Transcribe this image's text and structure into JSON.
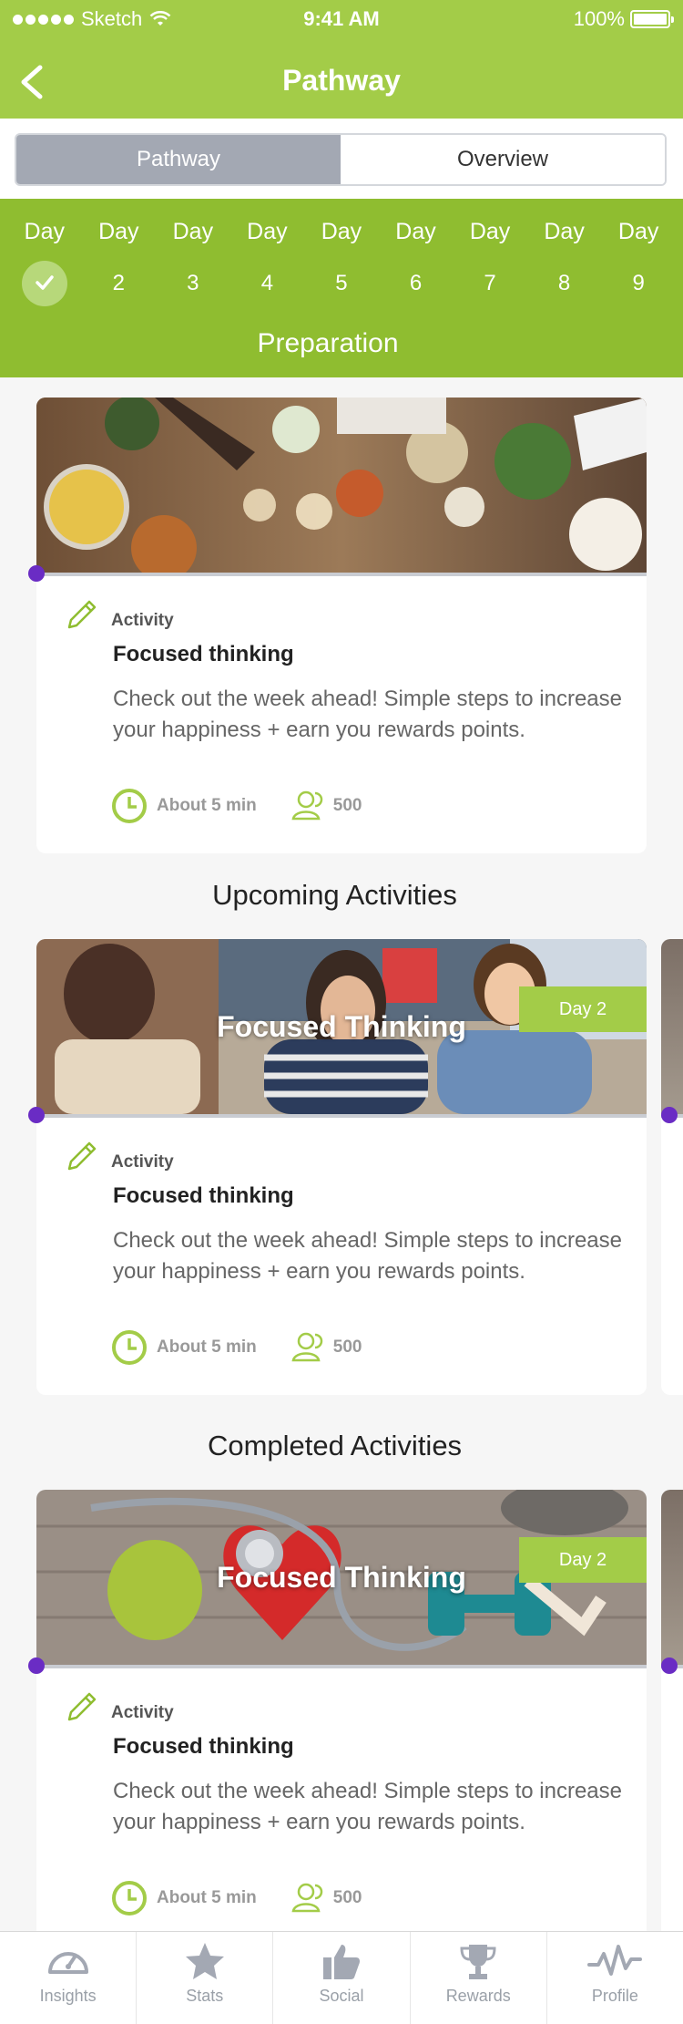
{
  "status": {
    "carrier": "Sketch",
    "time": "9:41 AM",
    "battery": "100%"
  },
  "nav": {
    "title": "Pathway"
  },
  "segments": {
    "left": "Pathway",
    "right": "Overview",
    "active": "Pathway"
  },
  "days": [
    {
      "label": "Day",
      "value": "",
      "completed": true
    },
    {
      "label": "Day",
      "value": "2"
    },
    {
      "label": "Day",
      "value": "3"
    },
    {
      "label": "Day",
      "value": "4"
    },
    {
      "label": "Day",
      "value": "5"
    },
    {
      "label": "Day",
      "value": "6"
    },
    {
      "label": "Day",
      "value": "7"
    },
    {
      "label": "Day",
      "value": "8"
    },
    {
      "label": "Day",
      "value": "9"
    }
  ],
  "phase": "Preparation",
  "cards": [
    {
      "type": "Activity",
      "title": "Focused thinking",
      "description": "Check out the week ahead! Simple steps to increase your happiness + earn you rewards points.",
      "duration": "About 5 min",
      "points": "500",
      "image": "friends-dinner-table"
    },
    {
      "overlay": "Focused Thinking",
      "badge": "Day 2",
      "type": "Activity",
      "title": "Focused thinking",
      "description": "Check out the week ahead! Simple steps to increase your happiness + earn you rewards points.",
      "duration": "About 5 min",
      "points": "500",
      "image": "friends-laughing"
    },
    {
      "overlay": "Focused Thinking",
      "badge": "Day 2",
      "type": "Activity",
      "title": "Focused thinking",
      "description": "Check out the week ahead! Simple steps to increase your happiness + earn you rewards points.",
      "duration": "About 5 min",
      "points": "500",
      "image": "apple-heart-stethoscope-dumbbell"
    }
  ],
  "sections": {
    "upcoming": "Upcoming Activities",
    "completed": "Completed Activities"
  },
  "tabs": [
    {
      "label": "Insights",
      "icon": "gauge-icon"
    },
    {
      "label": "Stats",
      "icon": "star-icon"
    },
    {
      "label": "Social",
      "icon": "thumbs-up-icon"
    },
    {
      "label": "Rewards",
      "icon": "trophy-icon"
    },
    {
      "label": "Profile",
      "icon": "activity-icon"
    }
  ],
  "colors": {
    "brand": "#a3cc48",
    "brand_dark": "#8fbd30",
    "accent_dot": "#6a2cc4"
  }
}
